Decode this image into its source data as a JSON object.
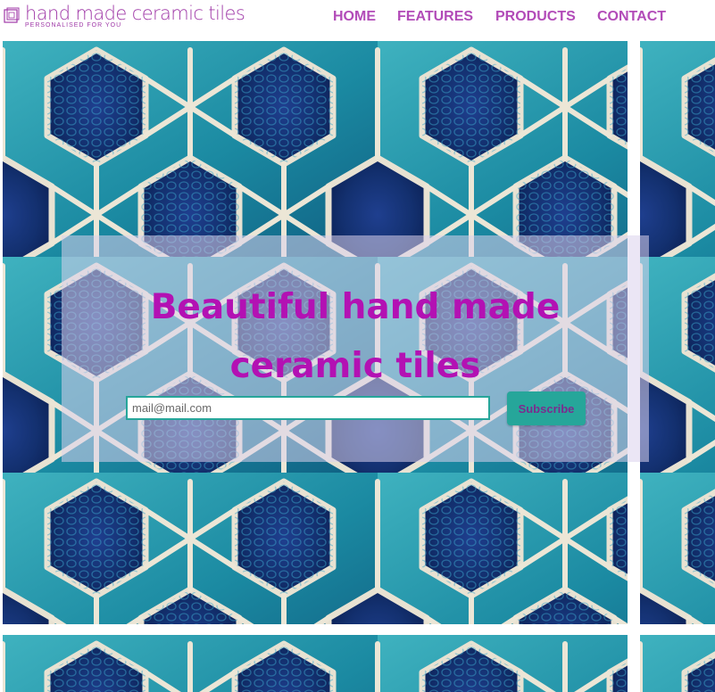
{
  "brand": {
    "title": "hand made ceramic tiles",
    "tagline": "PERSONALISED FOR YOU",
    "color": "#a03aa8"
  },
  "nav": {
    "items": [
      {
        "label": "HOME"
      },
      {
        "label": "FEATURES"
      },
      {
        "label": "PRODUCTS"
      },
      {
        "label": "CONTACT"
      }
    ],
    "color": "#b24bb8"
  },
  "hero": {
    "title_line1": "Beautiful hand made",
    "title_line2": "ceramic tiles",
    "title_color": "#b311b3"
  },
  "subscribe": {
    "email_placeholder": "mail@mail.com",
    "button_label": "Subscribe",
    "accent": "#26a69a"
  },
  "background": {
    "image": "hexagonal star ceramic tile pattern",
    "colors": [
      "#0f2f72",
      "#1d7fa0",
      "#2aa3b0",
      "#e8e2d2"
    ]
  }
}
